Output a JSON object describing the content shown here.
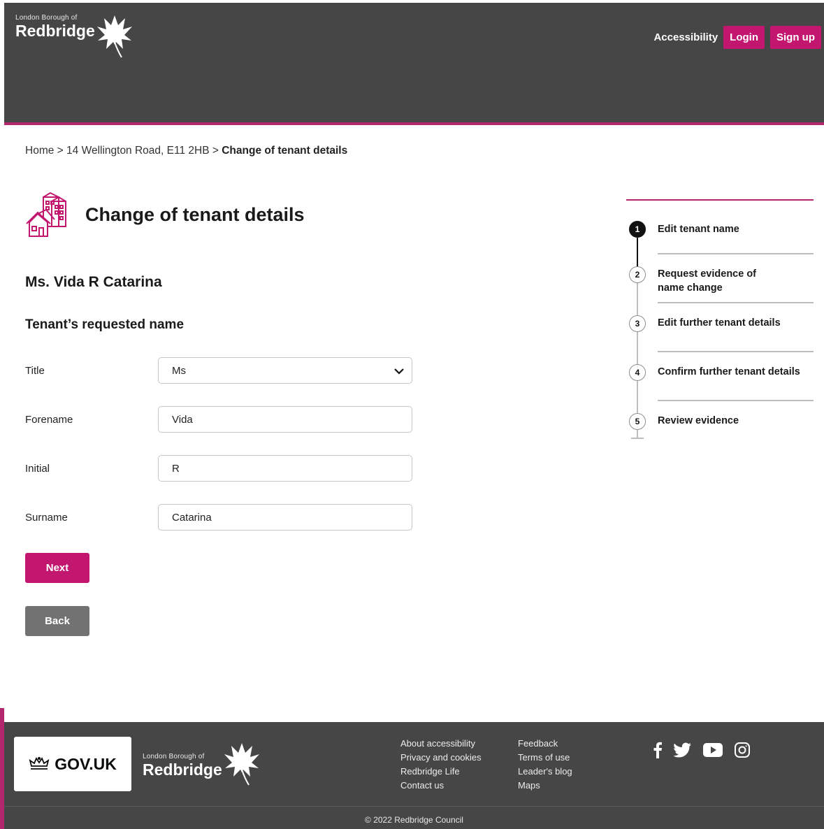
{
  "header": {
    "logo_small": "London Borough of",
    "logo_big": "Redbridge",
    "nav": {
      "accessibility": "Accessibility",
      "login": "Login",
      "signup": "Sign up"
    }
  },
  "breadcrumb": {
    "home": "Home",
    "sep": ">",
    "address": "14  Wellington Road, E11 2HB",
    "current": "Change of tenant details"
  },
  "page": {
    "title": "Change of tenant details",
    "tenant_name": "Ms. Vida R Catarina",
    "section_title": "Tenant’s requested name"
  },
  "form": {
    "title_label": "Title",
    "title_value": "Ms",
    "forename_label": "Forename",
    "forename_value": "Vida",
    "initial_label": "Initial",
    "initial_value": "R",
    "surname_label": "Surname",
    "surname_value": "Catarina"
  },
  "buttons": {
    "next": "Next",
    "back": "Back"
  },
  "steps": [
    {
      "num": "1",
      "label": "Edit tenant name"
    },
    {
      "num": "2",
      "label": "Request evidence of name change"
    },
    {
      "num": "3",
      "label": "Edit further tenant details"
    },
    {
      "num": "4",
      "label": "Confirm further tenant details"
    },
    {
      "num": "5",
      "label": "Review evidence"
    }
  ],
  "footer": {
    "gov": "GOV.UK",
    "logo_small": "London Borough of",
    "logo_big": "Redbridge",
    "links_col1": [
      "About accessibility",
      "Privacy and cookies",
      "Redbridge Life",
      "Contact us"
    ],
    "links_col2": [
      "Feedback",
      "Terms of use",
      "Leader's blog",
      "Maps"
    ],
    "copyright": "© 2022 Redbridge Council"
  },
  "colors": {
    "brand": "#c2166f",
    "header_bg": "#464646",
    "back_button": "#727272"
  },
  "icons": [
    "leaf-logo-icon",
    "buildings-icon",
    "chevron-down-icon",
    "crown-icon",
    "facebook-icon",
    "twitter-icon",
    "youtube-icon",
    "instagram-icon"
  ]
}
